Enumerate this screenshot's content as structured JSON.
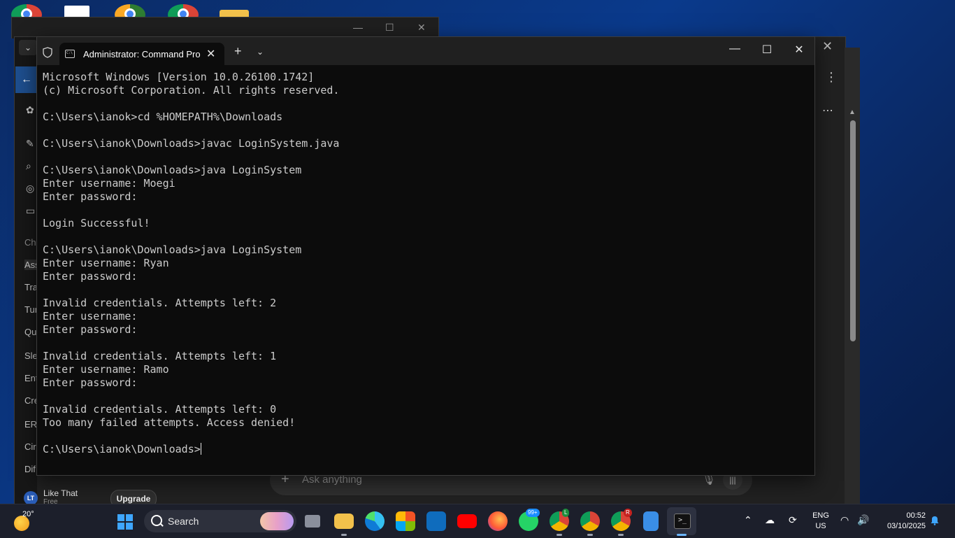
{
  "terminal": {
    "tab_title": "Administrator: Command Pro",
    "lines": [
      "Microsoft Windows [Version 10.0.26100.1742]",
      "(c) Microsoft Corporation. All rights reserved.",
      "",
      "C:\\Users\\ianok>cd %HOMEPATH%\\Downloads",
      "",
      "C:\\Users\\ianok\\Downloads>javac LoginSystem.java",
      "",
      "C:\\Users\\ianok\\Downloads>java LoginSystem",
      "Enter username: Moegi",
      "Enter password:",
      "",
      "Login Successful!",
      "",
      "C:\\Users\\ianok\\Downloads>java LoginSystem",
      "Enter username: Ryan",
      "Enter password:",
      "",
      "Invalid credentials. Attempts left: 2",
      "Enter username:",
      "Enter password:",
      "",
      "Invalid credentials. Attempts left: 1",
      "Enter username: Ramo",
      "Enter password:",
      "",
      "Invalid credentials. Attempts left: 0",
      "Too many failed attempts. Access denied!",
      ""
    ],
    "prompt": "C:\\Users\\ianok\\Downloads>"
  },
  "background_app": {
    "sidebar_items": [
      "Ch",
      "Ass",
      "Tra",
      "Tur",
      "Qu",
      "Sle",
      "Ent",
      "Cre",
      "ERI",
      "Cir",
      "Dif"
    ],
    "ask_placeholder": "Ask anything",
    "user": {
      "initials": "LT",
      "name": "Like That",
      "plan": "Free"
    },
    "upgrade_label": "Upgrade"
  },
  "taskbar": {
    "weather_temp": "20°",
    "search_label": "Search",
    "whatsapp_badge": "99+",
    "chrome_badge_1": "L",
    "chrome_badge_2": "R",
    "lang_top": "ENG",
    "lang_bottom": "US",
    "time": "00:52",
    "date": "03/10/2025"
  },
  "colors": {
    "console_bg": "#0c0c0c",
    "console_text": "#cccccc",
    "titlebar": "#202020",
    "taskbar": "#1c1f2b",
    "accent": "#3ea6ff"
  }
}
